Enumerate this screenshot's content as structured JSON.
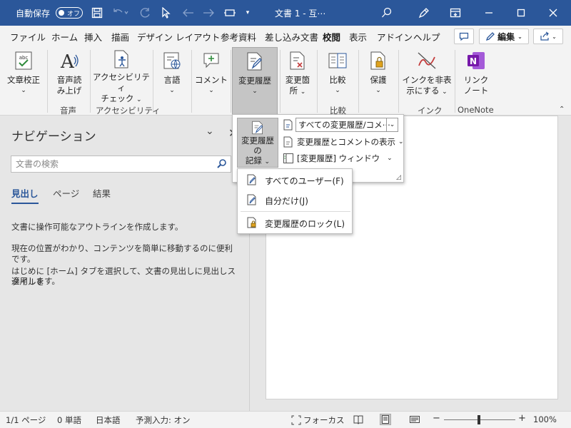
{
  "titlebar": {
    "autosave_label": "自動保存",
    "autosave_state": "オフ",
    "document_title": "文書 1  -  互⋯"
  },
  "tabs": [
    "ファイル",
    "ホーム",
    "挿入",
    "描画",
    "デザイン",
    "レイアウト",
    "参考資料",
    "差し込み文書",
    "校閲",
    "表示",
    "アドイン",
    "ヘルプ"
  ],
  "active_tab": "校閲",
  "edit_button": "編集",
  "ribbon": {
    "proofing": "文章校正",
    "read_aloud_1": "音声読",
    "read_aloud_2": "み上げ",
    "accessibility_1": "アクセシビリティ",
    "accessibility_2": "チェック",
    "language": "言語",
    "comment": "コメント",
    "track_changes": "変更履歴",
    "changes_1": "変更箇",
    "changes_2": "所",
    "compare": "比較",
    "protect": "保護",
    "ink_1": "インクを非表",
    "ink_2": "示にする",
    "link_1": "リンク",
    "link_2": "ノート",
    "groups": {
      "speech": "音声",
      "accessibility": "アクセシビリティ",
      "compare": "比較",
      "ink": "インク",
      "onenote": "OneNote"
    }
  },
  "track_panel": {
    "record_1": "変更履歴の",
    "record_2": "記録",
    "markup_select": "すべての変更履歴/コメ⋯",
    "show_markup": "変更履歴とコメントの表示",
    "reviewing_pane": "[変更履歴] ウィンドウ"
  },
  "user_menu": {
    "all_users": "すべてのユーザー(F)",
    "just_me": "自分だけ(J)",
    "lock": "変更履歴のロック(L)"
  },
  "navpane": {
    "title": "ナビゲーション",
    "search_placeholder": "文書の検索",
    "tabs": [
      "見出し",
      "ページ",
      "結果"
    ],
    "line1": "文書に操作可能なアウトラインを作成します。",
    "line2": "現在の位置がわかり、コンテンツを簡単に移動するのに便利です。",
    "line3": "はじめに [ホーム] タブを選択して、文書の見出しに見出しスタイルを",
    "line4": "適用します。"
  },
  "statusbar": {
    "page": "1/1 ページ",
    "words": "0 単語",
    "language": "日本語",
    "predict": "予測入力: オン",
    "focus": "フォーカス",
    "zoom": "100%"
  },
  "colors": {
    "titlebar": "#2b579a",
    "ribbon": "#f3f3f3",
    "pane": "#e6e6e6",
    "onenote": "#7719aa"
  }
}
